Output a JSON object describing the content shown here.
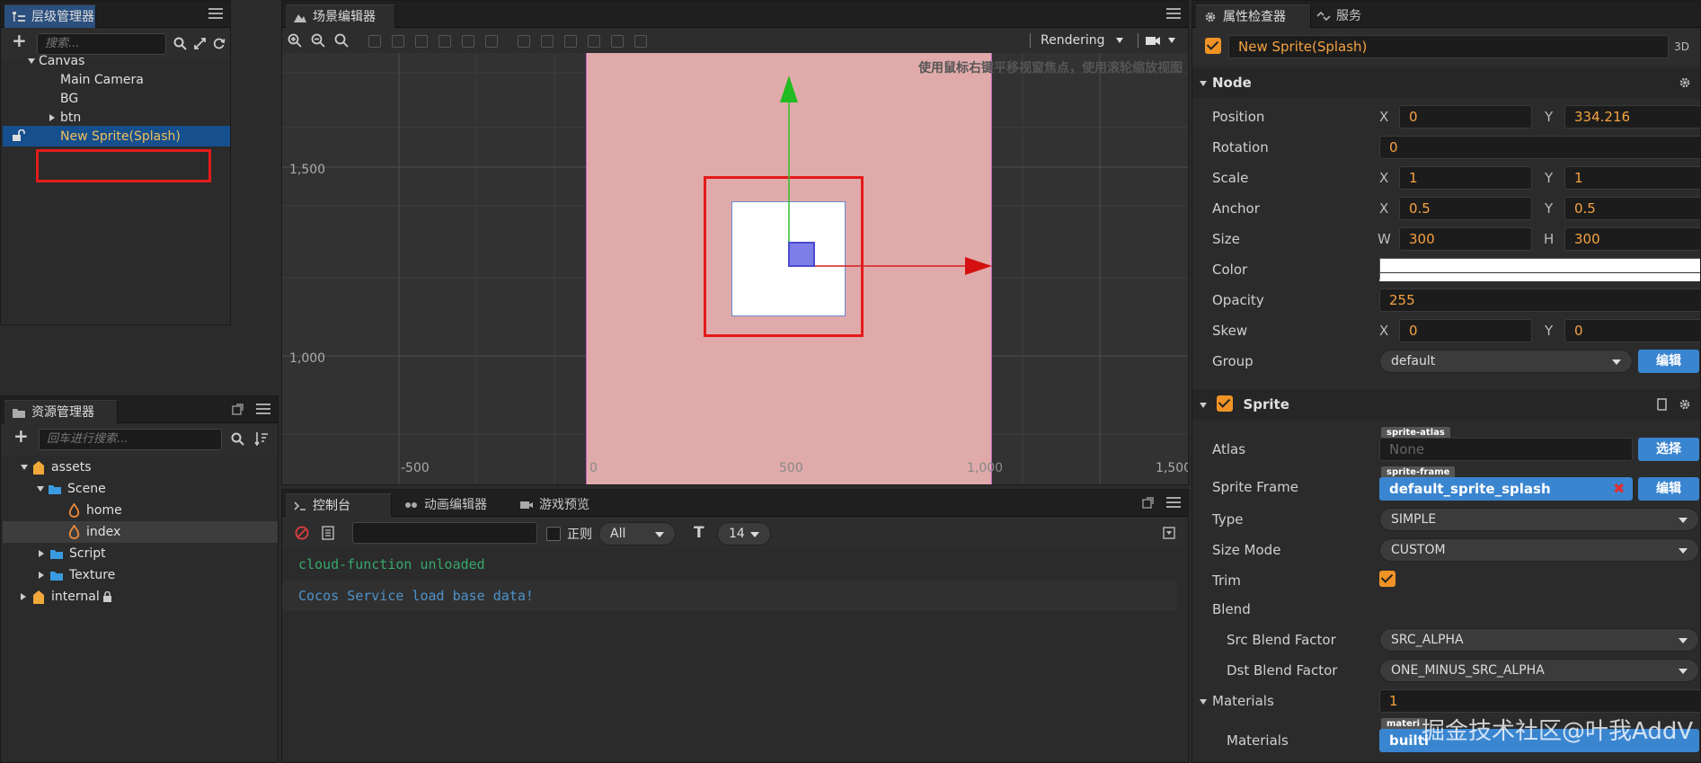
{
  "hierarchy": {
    "tab": "层级管理器",
    "search_placeholder": "搜索...",
    "items": [
      {
        "label": "Canvas"
      },
      {
        "label": "Main Camera"
      },
      {
        "label": "BG"
      },
      {
        "label": "btn"
      },
      {
        "label": "New Sprite(Splash)"
      }
    ]
  },
  "assets": {
    "tab": "资源管理器",
    "search_placeholder": "回车进行搜索...",
    "items": [
      {
        "label": "assets"
      },
      {
        "label": "Scene"
      },
      {
        "label": "home"
      },
      {
        "label": "index"
      },
      {
        "label": "Script"
      },
      {
        "label": "Texture"
      },
      {
        "label": "internal"
      }
    ]
  },
  "scene": {
    "tab": "场景编辑器",
    "rendering": "Rendering",
    "hint": "使用鼠标右键平移视窗焦点，使用滚轮缩放视图",
    "ticks_y": [
      "1,500",
      "1,000"
    ],
    "ticks_x": [
      "-500",
      "0",
      "500",
      "1,000",
      "1,500"
    ],
    "colors": {
      "canvas": "#e0aaaa",
      "select": "#ff0000"
    }
  },
  "console": {
    "tabs": [
      "控制台",
      "动画编辑器",
      "游戏预览"
    ],
    "regex_label": "正则",
    "level": "All",
    "font_size": "14",
    "lines": [
      "cloud-function unloaded",
      "Cocos Service load base data!"
    ]
  },
  "inspector": {
    "tabs": [
      "属性检查器",
      "服务"
    ],
    "node_name": "New Sprite(Splash)",
    "mode_3d": "3D",
    "node_section": "Node",
    "position": {
      "label": "Position",
      "x": "0",
      "y": "334.216"
    },
    "rotation": {
      "label": "Rotation",
      "value": "0"
    },
    "scale": {
      "label": "Scale",
      "x": "1",
      "y": "1"
    },
    "anchor": {
      "label": "Anchor",
      "x": "0.5",
      "y": "0.5"
    },
    "size": {
      "label": "Size",
      "w": "300",
      "h": "300"
    },
    "color": {
      "label": "Color"
    },
    "opacity": {
      "label": "Opacity",
      "value": "255"
    },
    "skew": {
      "label": "Skew",
      "x": "0",
      "y": "0"
    },
    "group": {
      "label": "Group",
      "value": "default",
      "edit": "编辑"
    },
    "axis": {
      "x": "X",
      "y": "Y",
      "w": "W",
      "h": "H"
    },
    "sprite_section": "Sprite",
    "atlas": {
      "label": "Atlas",
      "badge": "sprite-atlas",
      "value": "None",
      "btn": "选择"
    },
    "sprite_frame": {
      "label": "Sprite Frame",
      "badge": "sprite-frame",
      "value": "default_sprite_splash",
      "btn": "编辑"
    },
    "type": {
      "label": "Type",
      "value": "SIMPLE"
    },
    "size_mode": {
      "label": "Size Mode",
      "value": "CUSTOM"
    },
    "trim": {
      "label": "Trim"
    },
    "blend": {
      "label": "Blend"
    },
    "src_blend": {
      "label": "Src Blend Factor",
      "value": "SRC_ALPHA"
    },
    "dst_blend": {
      "label": "Dst Blend Factor",
      "value": "ONE_MINUS_SRC_ALPHA"
    },
    "materials_count": {
      "label": "Materials",
      "value": "1"
    },
    "materials": {
      "label": "Materials",
      "badge": "materi",
      "value": "builti"
    },
    "watermark": "掘金技术社区@叶我AddV"
  }
}
